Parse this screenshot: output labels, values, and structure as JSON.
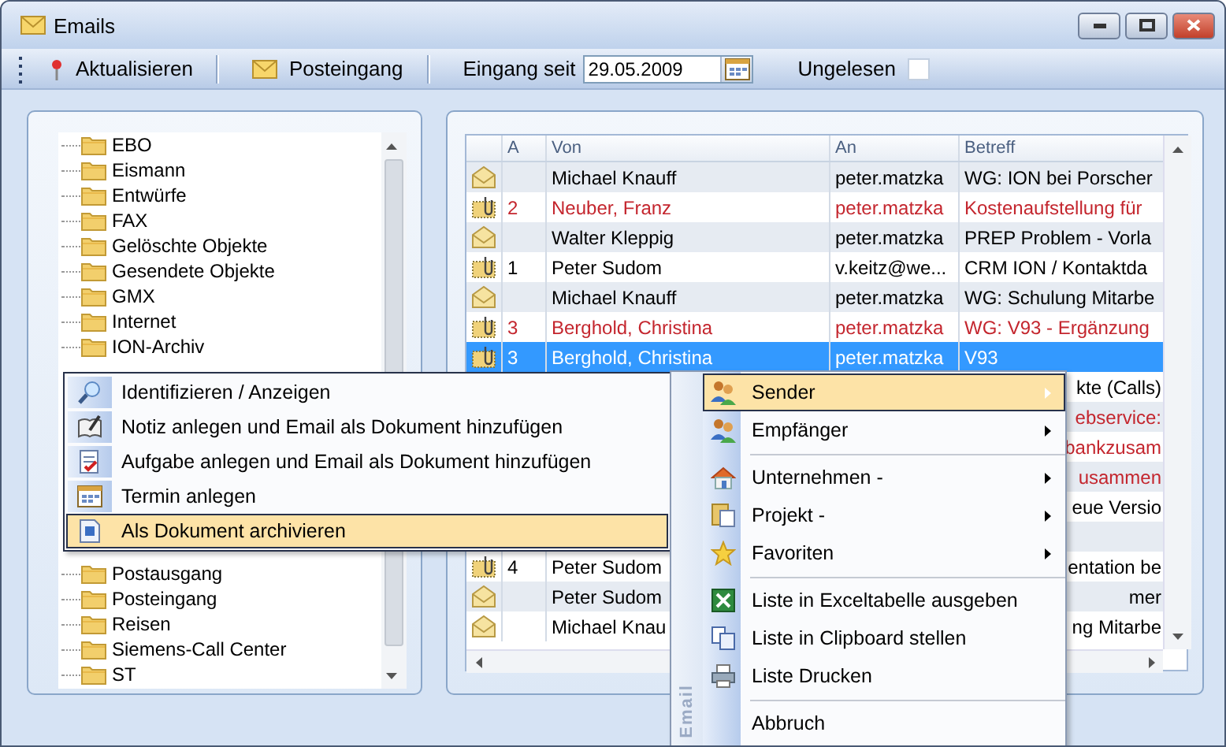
{
  "window": {
    "title": "Emails"
  },
  "toolbar": {
    "buttons": [
      {
        "label": "Aktualisieren"
      },
      {
        "label": "Posteingang"
      }
    ],
    "date_label": "Eingang seit",
    "date_value": "29.05.2009",
    "unread_label": "Ungelesen",
    "unread_checked": false
  },
  "folders": [
    {
      "label": "EBO"
    },
    {
      "label": "Eismann"
    },
    {
      "label": "Entwürfe"
    },
    {
      "label": "FAX"
    },
    {
      "label": "Gelöschte Objekte"
    },
    {
      "label": "Gesendete Objekte"
    },
    {
      "label": "GMX"
    },
    {
      "label": "Internet"
    },
    {
      "label": "ION-Archiv"
    },
    {
      "label": "Postausgang"
    },
    {
      "label": "Posteingang"
    },
    {
      "label": "Reisen"
    },
    {
      "label": "Siemens-Call Center"
    },
    {
      "label": "ST"
    }
  ],
  "table": {
    "columns": [
      "A",
      "Von",
      "An",
      "Betreff"
    ],
    "rows": [
      {
        "attachment": false,
        "from": "Michael Knauff",
        "to": "peter.matzka",
        "subject": "WG: ION bei Porscher",
        "color": "#000000",
        "selected": false
      },
      {
        "attachment": true,
        "a": "2",
        "from": "Neuber, Franz",
        "to": "peter.matzka",
        "subject": "Kostenaufstellung für",
        "color": "#c4262e",
        "selected": false
      },
      {
        "attachment": false,
        "from": "Walter Kleppig",
        "to": "peter.matzka",
        "subject": "PREP Problem - Vorla",
        "color": "#000000",
        "selected": false
      },
      {
        "attachment": true,
        "a": "1",
        "from": "Peter Sudom",
        "to": "v.keitz@we...",
        "subject": "CRM ION / Kontaktda",
        "color": "#000000",
        "selected": false
      },
      {
        "attachment": false,
        "from": "Michael Knauff",
        "to": "peter.matzka",
        "subject": "WG: Schulung Mitarbe",
        "color": "#000000",
        "selected": false
      },
      {
        "attachment": true,
        "a": "3",
        "from": "Berghold, Christina",
        "to": "peter.matzka",
        "subject": "WG: V93 - Ergänzung",
        "color": "#c4262e",
        "selected": false
      },
      {
        "attachment": true,
        "a": "3",
        "from": "Berghold, Christina",
        "to": "peter.matzka",
        "subject": "V93",
        "color": "#ffffff",
        "selected": true
      },
      {
        "subject": "kte (Calls)",
        "color": "#000000",
        "selected": false
      },
      {
        "subject": "ebservice:",
        "color": "#c4262e",
        "selected": false
      },
      {
        "subject": "bankzusam",
        "color": "#c4262e",
        "selected": false
      },
      {
        "subject": "usammen",
        "color": "#c4262e",
        "selected": false
      },
      {
        "subject": "eue Versio",
        "color": "#000000",
        "selected": false
      },
      {
        "selected": false
      },
      {
        "attachment": true,
        "a": "4",
        "from": "Peter Sudom",
        "subject": "entation be",
        "color": "#000000",
        "selected": false
      },
      {
        "attachment": false,
        "from": "Peter Sudom",
        "subject": "mer",
        "color": "#000000",
        "selected": false
      },
      {
        "attachment": false,
        "from": "Michael Knau",
        "subject": "ng Mitarbe",
        "color": "#000000",
        "selected": false
      }
    ]
  },
  "context_menu": {
    "items": [
      {
        "label": "Identifizieren / Anzeigen",
        "selected": false
      },
      {
        "label": "Notiz anlegen und Email als Dokument hinzufügen",
        "selected": false
      },
      {
        "label": "Aufgabe anlegen und Email als Dokument hinzufügen",
        "selected": false
      },
      {
        "label": "Termin anlegen",
        "selected": false
      },
      {
        "label": "Als Dokument archivieren",
        "selected": true
      }
    ]
  },
  "email_menu": {
    "side_label": "Email",
    "items": [
      {
        "kind": "item",
        "label": "Sender",
        "submenu": true,
        "selected": true
      },
      {
        "kind": "item",
        "label": "Empfänger",
        "submenu": true,
        "selected": false
      },
      {
        "kind": "separator"
      },
      {
        "kind": "item",
        "label": "Unternehmen -",
        "submenu": true,
        "selected": false
      },
      {
        "kind": "item",
        "label": "Projekt -",
        "submenu": true,
        "selected": false
      },
      {
        "kind": "item",
        "label": "Favoriten",
        "submenu": true,
        "selected": false
      },
      {
        "kind": "separator"
      },
      {
        "kind": "item",
        "label": "Liste in Exceltabelle ausgeben",
        "submenu": false,
        "selected": false
      },
      {
        "kind": "item",
        "label": "Liste in Clipboard stellen",
        "submenu": false,
        "selected": false
      },
      {
        "kind": "item",
        "label": "Liste Drucken",
        "submenu": false,
        "selected": false
      },
      {
        "kind": "separator"
      },
      {
        "kind": "item",
        "label": "Abbruch",
        "submenu": false,
        "selected": false
      }
    ]
  }
}
